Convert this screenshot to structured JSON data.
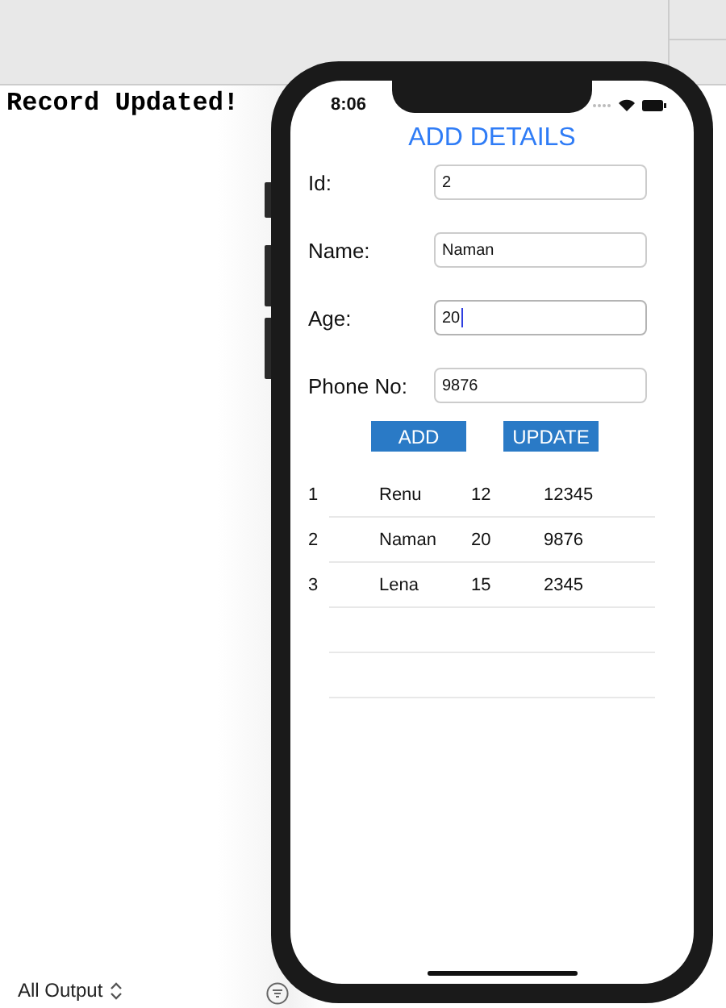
{
  "console": {
    "message": "Record Updated!",
    "filter": "All Output"
  },
  "phone": {
    "time": "8:06",
    "title": "ADD DETAILS",
    "fields": [
      {
        "label": "Id:",
        "value": "2",
        "focused": false
      },
      {
        "label": "Name:",
        "value": "Naman",
        "focused": false
      },
      {
        "label": "Age:",
        "value": "20",
        "focused": true
      },
      {
        "label": "Phone No:",
        "value": "9876",
        "focused": false
      }
    ],
    "buttons": [
      "ADD",
      "UPDATE"
    ],
    "rows": [
      [
        "1",
        "Renu",
        "12",
        "12345"
      ],
      [
        "2",
        "Naman",
        "20",
        "9876"
      ],
      [
        "3",
        "Lena",
        "15",
        "2345"
      ]
    ]
  }
}
